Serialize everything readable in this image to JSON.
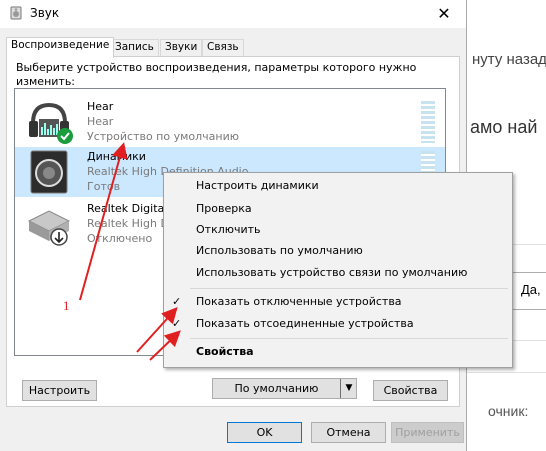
{
  "background": {
    "text1": "нуту назад",
    "text2": "амо най",
    "text3": "очник:",
    "button_label": "Да,"
  },
  "window": {
    "title": "Звук",
    "close_glyph": "✕"
  },
  "tabs": [
    {
      "label": "Воспроизведение",
      "active": true
    },
    {
      "label": "Запись"
    },
    {
      "label": "Звуки"
    },
    {
      "label": "Связь"
    }
  ],
  "instruction": "Выберите устройство воспроизведения, параметры которого нужно изменить:",
  "devices": [
    {
      "name": "Hear",
      "sub": "Hear",
      "status": "Устройство по умолчанию",
      "icon": "headphones-icon",
      "badge": "default-check"
    },
    {
      "name": "Динамики",
      "sub": "Realtek High Definition Audio",
      "status": "Готов",
      "icon": "speaker-icon",
      "selected": true
    },
    {
      "name": "Realtek Digital Output",
      "sub": "Realtek High Definition Audio",
      "status": "Отключено",
      "icon": "digital-output-icon",
      "badge": "disabled-arrow"
    }
  ],
  "buttons": {
    "configure": "Настроить",
    "default": "По умолчанию",
    "properties": "Свойства",
    "ok": "OK",
    "cancel": "Отмена",
    "apply": "Применить"
  },
  "context_menu": {
    "items": [
      {
        "label": "Настроить динамики"
      },
      {
        "label": "Проверка"
      },
      {
        "label": "Отключить"
      },
      {
        "label": "Использовать по умолчанию"
      },
      {
        "label": "Использовать устройство связи по умолчанию"
      },
      {
        "label": "Показать отключенные устройства",
        "checked": true
      },
      {
        "label": "Показать отсоединенные устройства",
        "checked": true
      },
      {
        "label": "Свойства",
        "bold": true
      }
    ]
  },
  "annotation": {
    "label": "1",
    "color": "#e02020"
  }
}
